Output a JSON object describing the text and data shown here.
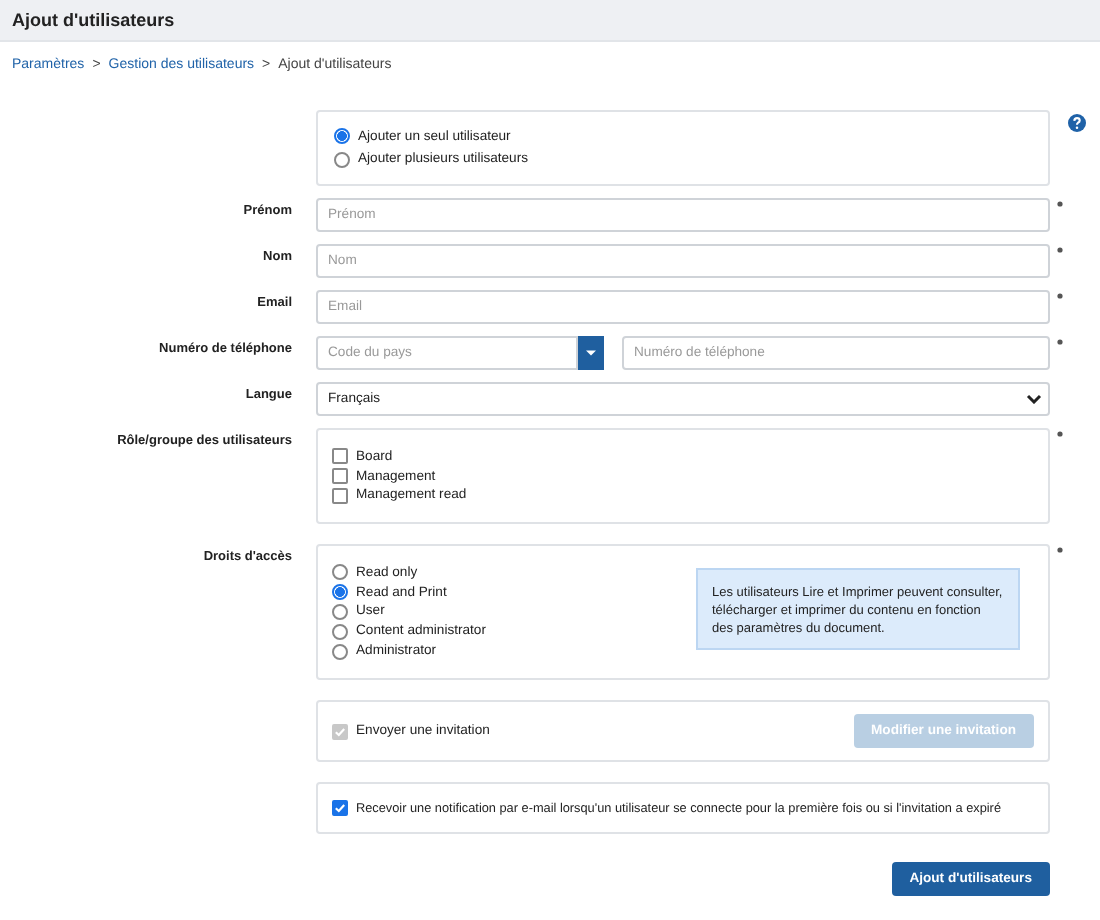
{
  "window": {
    "title": "Ajout d'utilisateurs"
  },
  "breadcrumb": [
    {
      "label": "Paramètres",
      "kind": "link"
    },
    {
      "label": ">",
      "kind": "separator"
    },
    {
      "label": "Gestion des utilisateurs",
      "kind": "link"
    },
    {
      "label": ">",
      "kind": "separator"
    },
    {
      "label": "Ajout d'utilisateurs",
      "kind": "current"
    }
  ],
  "mode_options": [
    {
      "label": "Ajouter un seul utilisateur",
      "selected": true
    },
    {
      "label": "Ajouter plusieurs utilisateurs",
      "selected": false
    }
  ],
  "fields": [
    {
      "label": "Prénom",
      "kind": "text",
      "placeholder": "Prénom",
      "required": true
    },
    {
      "label": "Nom",
      "kind": "text",
      "placeholder": "Nom",
      "required": true
    },
    {
      "label": "Email",
      "kind": "text",
      "placeholder": "Email",
      "required": true
    },
    {
      "label": "Numéro de téléphone",
      "kind": "phone",
      "country_placeholder": "Code du pays",
      "placeholder": "Numéro de téléphone",
      "required": true
    },
    {
      "label": "Langue",
      "kind": "select",
      "value": "Français",
      "required": false
    },
    {
      "label": "Rôle/groupe des utilisateurs",
      "kind": "checkboxes",
      "required": true,
      "options": [
        {
          "label": "Board",
          "checked": false
        },
        {
          "label": "Management",
          "checked": false
        },
        {
          "label": "Management read",
          "checked": false
        }
      ]
    },
    {
      "label": "Droits d'accès",
      "kind": "radios",
      "required": true,
      "options": [
        {
          "label": "Read only",
          "selected": false
        },
        {
          "label": "Read and Print",
          "selected": true
        },
        {
          "label": "User",
          "selected": false
        },
        {
          "label": "Content administrator",
          "selected": false
        },
        {
          "label": "Administrator",
          "selected": false
        }
      ],
      "info": "Les utilisateurs Lire et Imprimer peuvent consulter, télécharger et imprimer du contenu en fonction des paramètres du document."
    }
  ],
  "invitation": {
    "label": "Envoyer une invitation",
    "checked": true,
    "disabled": true,
    "button": {
      "label": "Modifier une invitation",
      "disabled": true
    }
  },
  "notification": {
    "label": "Recevoir une notification par e-mail lorsqu'un utilisateur se connecte pour la première fois ou si l'invitation a expiré",
    "checked": true
  },
  "submit": {
    "label": "Ajout d'utilisateurs"
  }
}
